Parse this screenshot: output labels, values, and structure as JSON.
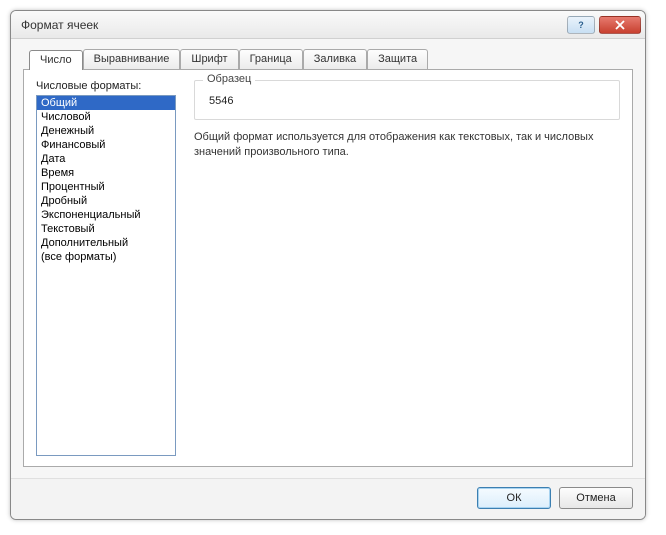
{
  "window": {
    "title": "Формат ячеек"
  },
  "tabs": [
    {
      "label": "Число",
      "active": true
    },
    {
      "label": "Выравнивание"
    },
    {
      "label": "Шрифт"
    },
    {
      "label": "Граница"
    },
    {
      "label": "Заливка"
    },
    {
      "label": "Защита"
    }
  ],
  "formats": {
    "label": "Числовые форматы:",
    "items": [
      "Общий",
      "Числовой",
      "Денежный",
      "Финансовый",
      "Дата",
      "Время",
      "Процентный",
      "Дробный",
      "Экспоненциальный",
      "Текстовый",
      "Дополнительный",
      "(все форматы)"
    ],
    "selected": 0
  },
  "sample": {
    "label": "Образец",
    "value": "5546"
  },
  "description": "Общий формат используется для отображения как текстовых, так и числовых значений произвольного типа.",
  "buttons": {
    "ok": "ОК",
    "cancel": "Отмена"
  }
}
